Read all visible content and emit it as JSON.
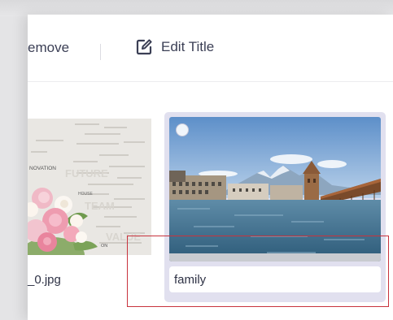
{
  "toolbar": {
    "remove_label": "emove",
    "edit_title_label": "Edit Title",
    "edit_icon": "edit-square-icon"
  },
  "images": [
    {
      "filename": "_0.jpg",
      "thumbnail": "collage-flowers-innovation",
      "overlay_words": [
        "NOVATION",
        "HOUSE",
        "ON"
      ]
    },
    {
      "thumbnail": "lake-bridge-tower-mountains",
      "title_value": "family",
      "selected": false
    }
  ],
  "colors": {
    "accent_card": "#e1e0ef",
    "highlight": "#c8333d",
    "text": "#3b3f55"
  }
}
